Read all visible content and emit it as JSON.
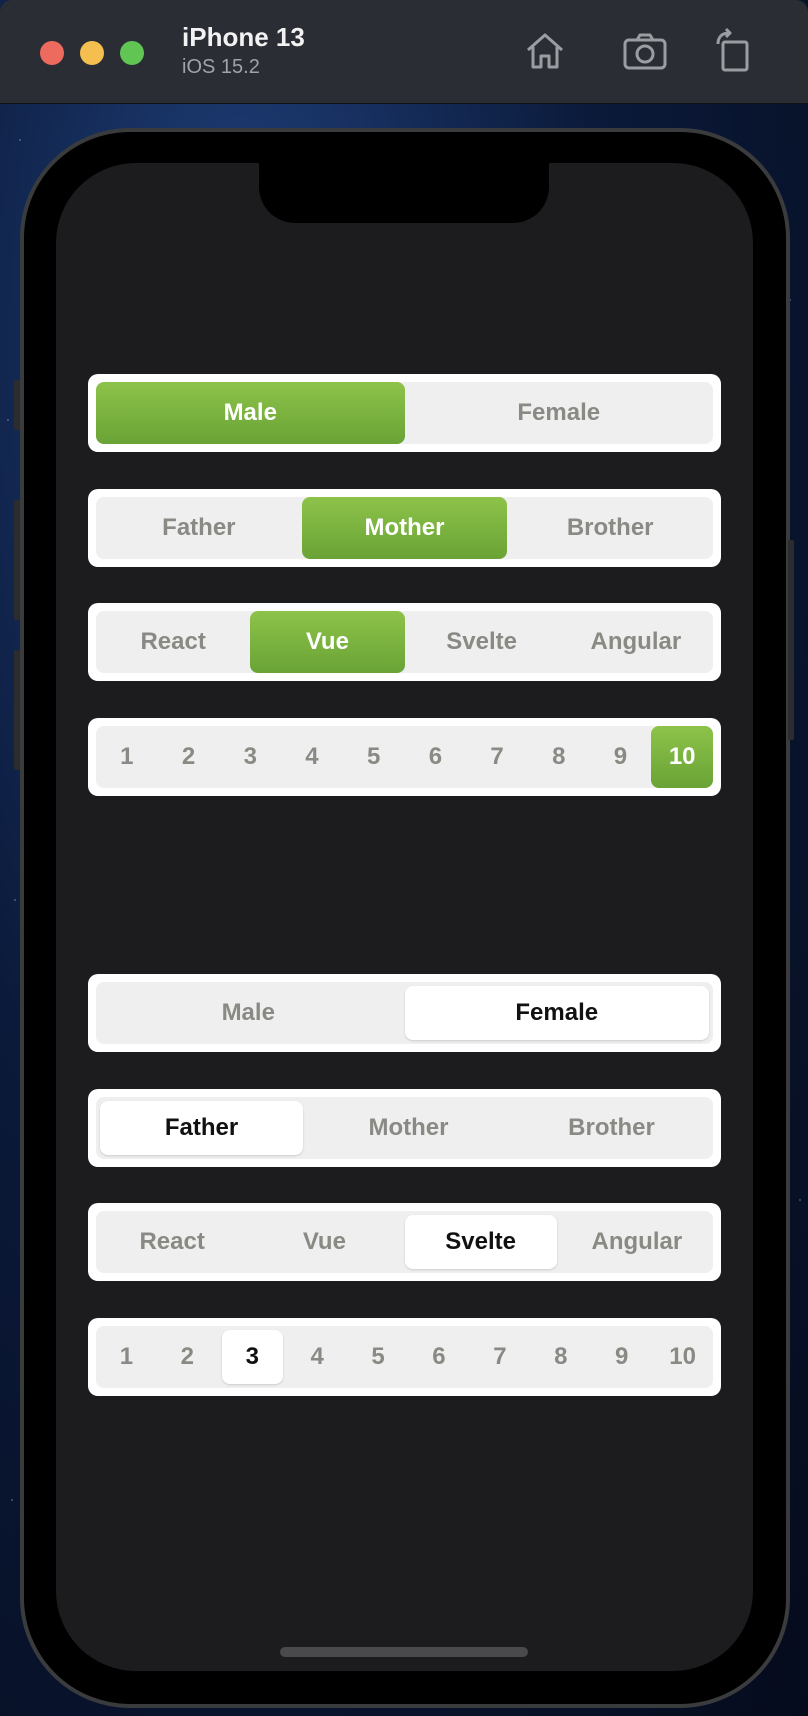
{
  "window": {
    "device_name": "iPhone 13",
    "os_version": "iOS 15.2",
    "toolbar_icons": [
      "home-icon",
      "screenshot-icon",
      "rotate-icon"
    ]
  },
  "colors": {
    "accent_green": "#7ab540",
    "selected_white": "#ffffff",
    "track": "#efefef",
    "screen_bg": "#1c1c1e"
  },
  "controls": {
    "gender_green": {
      "options": [
        "Male",
        "Female"
      ],
      "selected": "Male"
    },
    "family_green": {
      "options": [
        "Father",
        "Mother",
        "Brother"
      ],
      "selected": "Mother"
    },
    "framework_green": {
      "options": [
        "React",
        "Vue",
        "Svelte",
        "Angular"
      ],
      "selected": "Vue"
    },
    "numbers_green": {
      "options": [
        "1",
        "2",
        "3",
        "4",
        "5",
        "6",
        "7",
        "8",
        "9",
        "10"
      ],
      "selected": "10"
    },
    "gender_white": {
      "options": [
        "Male",
        "Female"
      ],
      "selected": "Female"
    },
    "family_white": {
      "options": [
        "Father",
        "Mother",
        "Brother"
      ],
      "selected": "Father"
    },
    "framework_white": {
      "options": [
        "React",
        "Vue",
        "Svelte",
        "Angular"
      ],
      "selected": "Svelte"
    },
    "numbers_white": {
      "options": [
        "1",
        "2",
        "3",
        "4",
        "5",
        "6",
        "7",
        "8",
        "9",
        "10"
      ],
      "selected": "3"
    }
  }
}
